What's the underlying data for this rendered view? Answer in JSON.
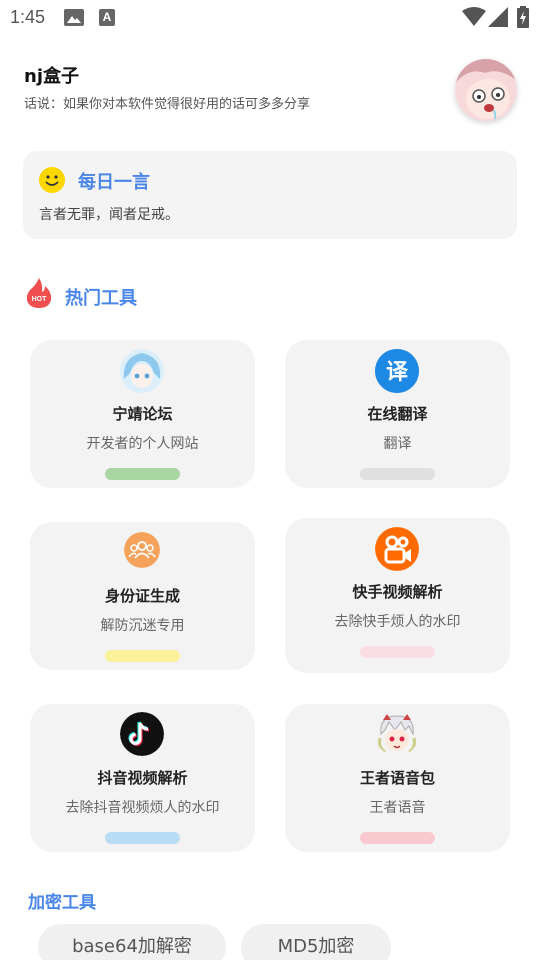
{
  "status_bar": {
    "time": "1:45",
    "a_glyph": "A"
  },
  "header": {
    "title": "nj盒子",
    "subtitle": "话说：如果你对本软件觉得很好用的话可多多分享"
  },
  "daily_quote": {
    "title": "每日一言",
    "text": "言者无罪，闻者足戒。"
  },
  "hot_tools": {
    "title": "热门工具",
    "hot_badge": "HOT",
    "items": [
      {
        "name": "宁靖论坛",
        "desc": "开发者的个人网站",
        "bar_color": "#a8d5a2",
        "icon": "anime-girl-blue-icon"
      },
      {
        "name": "在线翻译",
        "desc": "翻译",
        "bar_color": "#e0e0e0",
        "icon": "translate-icon",
        "icon_char": "译"
      },
      {
        "name": "身份证生成",
        "desc": "解防沉迷专用",
        "bar_color": "#fbf19a",
        "icon": "people-icon"
      },
      {
        "name": "快手视频解析",
        "desc": "去除快手烦人的水印",
        "bar_color": "#fbdde4",
        "icon": "kuaishou-icon"
      },
      {
        "name": "抖音视频解析",
        "desc": "去除抖音视频烦人的水印",
        "bar_color": "#b9dcf5",
        "icon": "tiktok-icon"
      },
      {
        "name": "王者语音包",
        "desc": "王者语音",
        "bar_color": "#f9c9d0",
        "icon": "anime-character-icon"
      }
    ]
  },
  "encrypt_tools": {
    "title": "加密工具",
    "chips": [
      "base64加解密",
      "MD5加密"
    ]
  },
  "colors": {
    "accent": "#4a86e8"
  }
}
